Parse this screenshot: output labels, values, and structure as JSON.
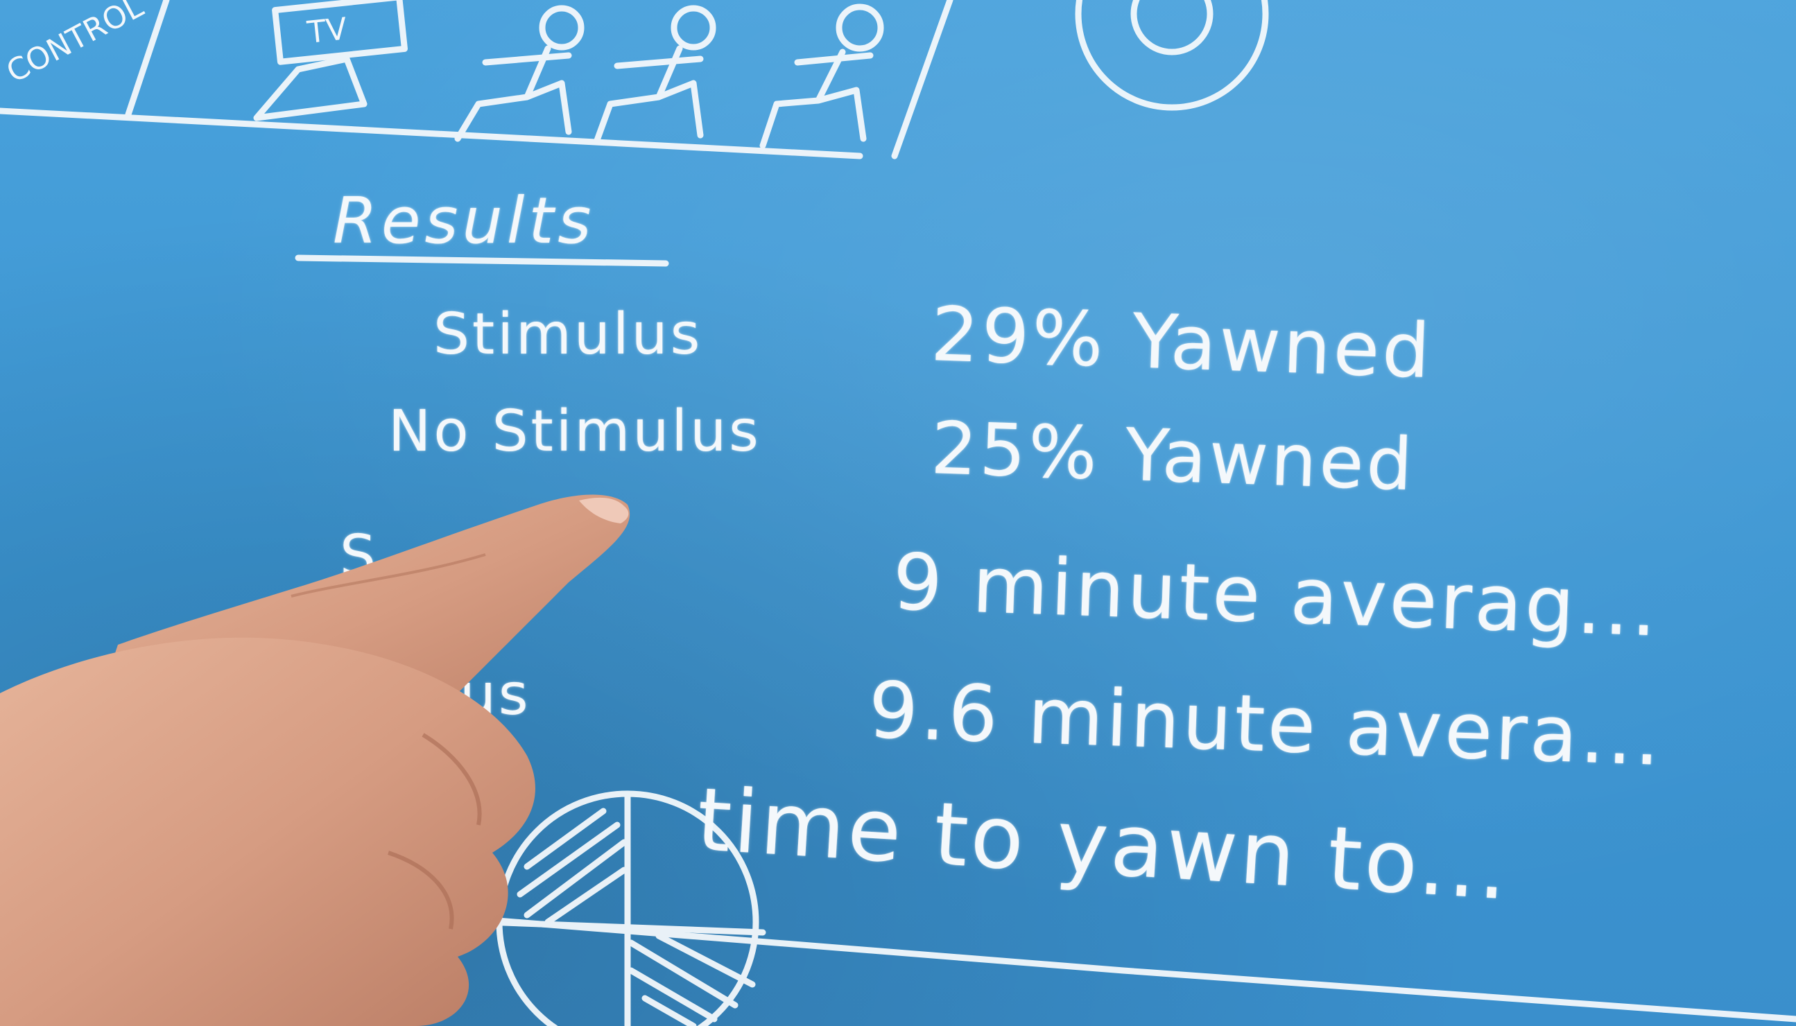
{
  "scene": {
    "description_type": "whiteboard-photo",
    "board_color": "#3f97d4",
    "chalk_color": "#f4f8fb",
    "skin_color": "#d9a48a"
  },
  "diagram": {
    "label_control": "CONTROL",
    "label_tv": "TV"
  },
  "results": {
    "title": "Results",
    "rows": [
      {
        "label": "Stimulus",
        "value": "29% Yawned"
      },
      {
        "label": "No Stimulus",
        "value": "25% Yawned"
      },
      {
        "label": "S...us",
        "value": "9 minute averag..."
      },
      {
        "label": "...ulus",
        "value": "9.6 minute avera..."
      }
    ],
    "bottom_line": "time to yawn to..."
  }
}
